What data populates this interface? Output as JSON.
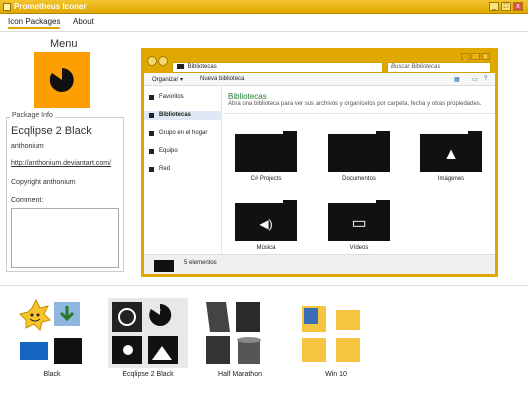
{
  "app": {
    "title": "Prometheus Iconer"
  },
  "tabs": [
    {
      "label": "Icon Packages"
    },
    {
      "label": "About"
    }
  ],
  "preview": {
    "title": "Menu",
    "tile_color": "#ff9e00"
  },
  "package_info": {
    "legend": "Package Info",
    "name": "Ecqlipse 2 Black",
    "author": "anthonium",
    "link": "http://anthonium.deviantart.com/",
    "copyright": "Copyright anthonium",
    "comment_label": "Comment:",
    "comment_value": ""
  },
  "explorer": {
    "address": "Bibliotecas",
    "search_placeholder": "Buscar Bibliotecas",
    "toolbar": {
      "organize": "Organizar ▾",
      "new_library": "Nueva biblioteca"
    },
    "sidebar": [
      {
        "label": "Favoritos"
      },
      {
        "label": "Bibliotecas"
      },
      {
        "label": "Grupo en el hogar"
      },
      {
        "label": "Equipo"
      },
      {
        "label": "Red"
      }
    ],
    "heading": "Bibliotecas",
    "subheading": "Abra una biblioteca para ver sus archivos y organícelos por carpeta, fecha y otras propiedades.",
    "folders": [
      {
        "label": "C# Projects",
        "glyph": ""
      },
      {
        "label": "Documentos",
        "glyph": ""
      },
      {
        "label": "Imágenes",
        "glyph": "▲"
      },
      {
        "label": "Música",
        "glyph": "◀)"
      },
      {
        "label": "Vídeos",
        "glyph": "▭"
      }
    ],
    "status": "5 elementos",
    "accent": "#e0a800"
  },
  "packs": [
    {
      "label": "Black"
    },
    {
      "label": "Ecqlipse 2 Black"
    },
    {
      "label": "Half Marathon"
    },
    {
      "label": "Win 10"
    }
  ]
}
